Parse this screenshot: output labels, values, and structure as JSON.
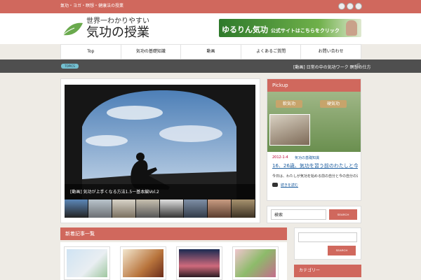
{
  "topbar": {
    "tagline": "氣功・ヨガ・瞑想・健康法の授業"
  },
  "social_icons": [
    "rss-icon",
    "twitter-icon",
    "facebook-icon"
  ],
  "header": {
    "logo_sub": "世界一わかりやすい",
    "logo_main": "気功の授業",
    "banner_text": "ゆるりん気功",
    "banner_sub": "公式サイトはこちらをクリック"
  },
  "nav": {
    "items": [
      "Top",
      "気功の基礎知識",
      "動画",
      "よくあるご質問",
      "お問い合わせ"
    ]
  },
  "topics": {
    "label": "TOPICS",
    "text": "[動画] 日常の中の気功ワーク 瞑想の仕方",
    "pause": "||"
  },
  "slider": {
    "caption": "[動画] 気功が上手くなる方法1.5ー基本編Vol.2"
  },
  "pickup": {
    "heading": "Pickup",
    "button_left": "軟気功",
    "button_right": "硬気功",
    "date": "2012-1-4",
    "category": "気功の基礎知識",
    "title": "16．26歳、気功を習う前のわたしと今の私の違い・・・",
    "excerpt": "今日は、わたしが気功を始める前の自分と今の自分の違いについて…",
    "more": "続きを読む"
  },
  "search1": {
    "value": "検索",
    "button": "SEARCH"
  },
  "main": {
    "heading": "新着記事一覧"
  },
  "search2": {
    "button": "SEARCH"
  },
  "sidebar": {
    "heading2": "カテゴリー"
  },
  "colors": {
    "accent": "#d0685d",
    "topics_bar": "#4f4f4f",
    "link": "#1f5fa0"
  }
}
